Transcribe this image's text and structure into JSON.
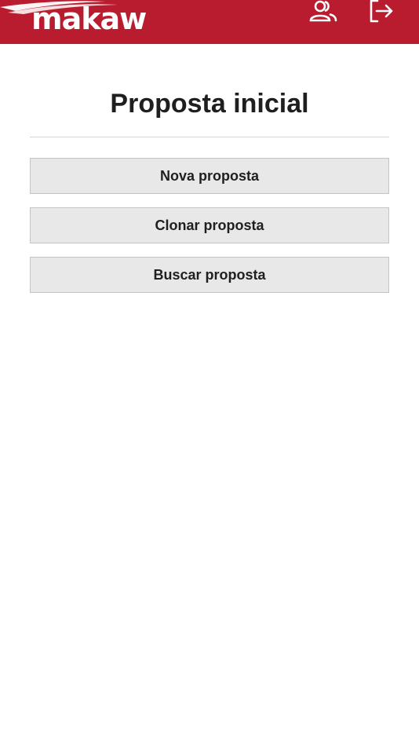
{
  "header": {
    "brand": "makaw",
    "icons": {
      "user": "user-group-icon",
      "logout": "logout-icon"
    },
    "colors": {
      "background": "#b91c2e",
      "foreground": "#ffffff"
    }
  },
  "main": {
    "title": "Proposta inicial",
    "buttons": [
      {
        "label": "Nova proposta"
      },
      {
        "label": "Clonar proposta"
      },
      {
        "label": "Buscar proposta"
      }
    ]
  }
}
